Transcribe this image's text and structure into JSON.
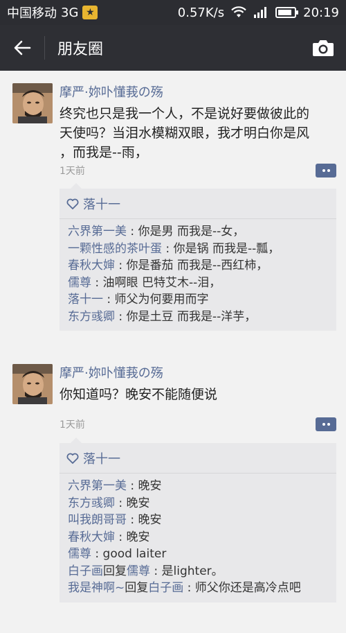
{
  "status_bar": {
    "carrier": "中国移动",
    "network": "3G",
    "speed": "0.57K/s",
    "time": "20:19",
    "battery_level": 0.85
  },
  "header": {
    "title": "朋友圈"
  },
  "posts": [
    {
      "author": "摩严·妳卟懂莪の殇",
      "content_lines": [
        "终究也只是我一个人，不是说好要做彼此的",
        "天使吗？当泪水模糊双眼，我才明白你是风",
        "，而我是--雨，"
      ],
      "time": "1天前",
      "likes": "落十一",
      "comments": [
        {
          "name": "六界第一美",
          "text": "你是男 而我是--女，"
        },
        {
          "name": "一颗性感的茶叶蛋",
          "text": "你是锅 而我是--瓢，"
        },
        {
          "name": "春秋大婶",
          "text": "你是番茄 而我是--西红柿，"
        },
        {
          "name": "儒尊",
          "text": "油啊眼 巴特艾木--泪，"
        },
        {
          "name": "落十一",
          "text": "师父为何要用而字"
        },
        {
          "name": "东方彧卿",
          "text": "你是土豆 而我是--洋芋，"
        }
      ]
    },
    {
      "author": "摩严·妳卟懂莪の殇",
      "content_lines": [
        "你知道吗？晚安不能随便说"
      ],
      "time": "1天前",
      "likes": "落十一",
      "comments": [
        {
          "name": "六界第一美",
          "text": "晚安"
        },
        {
          "name": "东方彧卿",
          "text": "晚安"
        },
        {
          "name": "叫我朗哥哥",
          "text": "晚安"
        },
        {
          "name": "春秋大婶",
          "text": "晚安"
        },
        {
          "name": "儒尊",
          "text": "good laiter"
        }
      ],
      "replies": [
        {
          "name": "白子画",
          "reply_word": "回复",
          "target": "儒尊",
          "text": "是lighter。"
        },
        {
          "name": "我是神啊~",
          "reply_word": "回复",
          "target": "白子画",
          "text": "师父你还是高冷点吧"
        }
      ]
    }
  ],
  "colors": {
    "link": "#576b95",
    "header_bg": "#2e2f34",
    "status_bg": "#2c2d32",
    "page_bg": "#f2f2f2",
    "comment_bg": "#e8e8ea"
  },
  "icons": [
    "star-badge-icon",
    "wifi-icon",
    "signal-icon",
    "battery-icon",
    "back-arrow-icon",
    "camera-icon",
    "comment-icon",
    "heart-icon"
  ]
}
